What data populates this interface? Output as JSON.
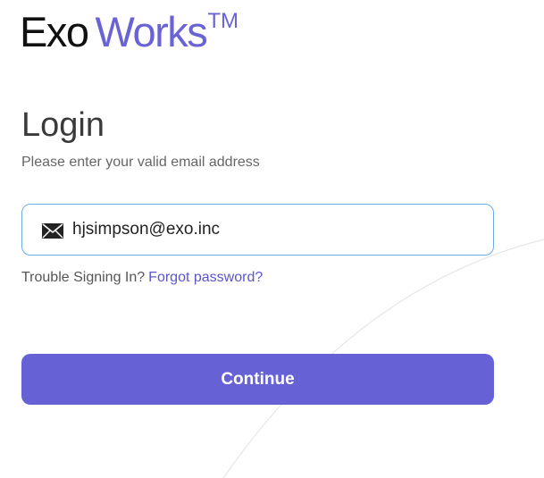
{
  "brand": {
    "name_part1": "Exo",
    "name_part2": "Works",
    "trademark": "TM"
  },
  "login": {
    "title": "Login",
    "subtitle": "Please enter your valid email address",
    "email_value": "hjsimpson@exo.inc",
    "email_icon": "mail-icon",
    "trouble_text": "Trouble Signing In?",
    "forgot_link": "Forgot password?",
    "continue_label": "Continue"
  },
  "colors": {
    "brand_purple": "#6662d6",
    "field_border": "#6aaee8",
    "text_dark": "#3a3a3a",
    "text_muted": "#666666"
  }
}
